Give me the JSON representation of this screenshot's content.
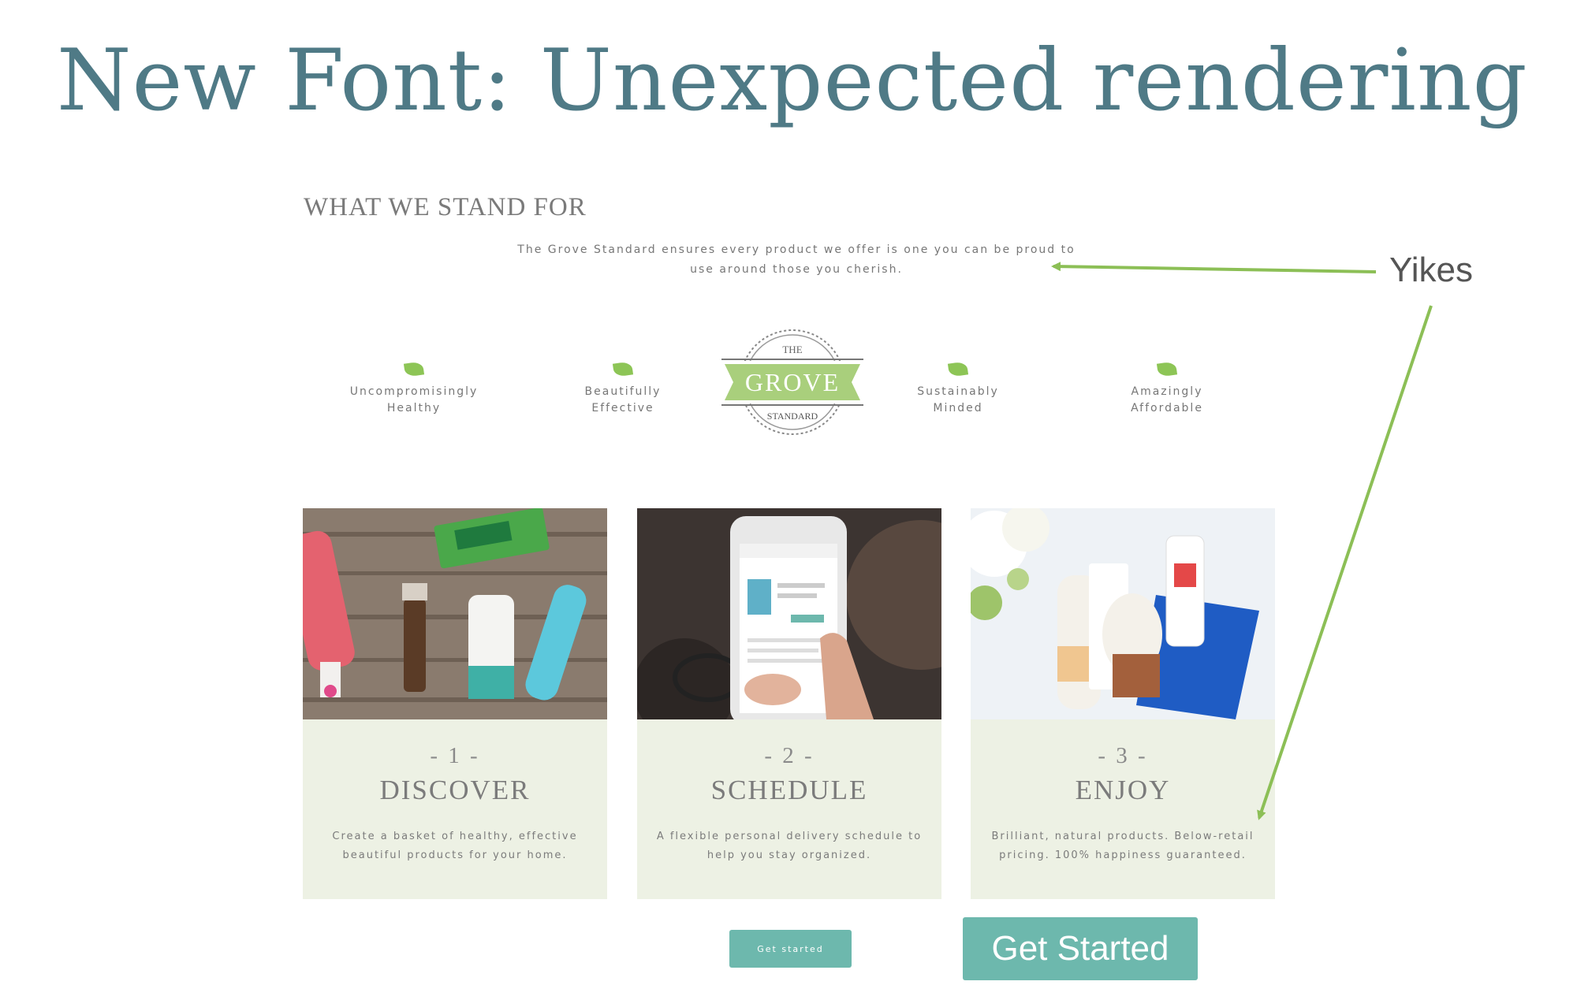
{
  "slide": {
    "title": "New Font: Unexpected rendering"
  },
  "section": {
    "heading": "WHAT WE STAND FOR",
    "tagline": "The Grove Standard ensures every product we offer is one you can be proud to use around those you cherish."
  },
  "pillars": [
    {
      "label": "Uncompromisingly\nHealthy"
    },
    {
      "label": "Beautifully\nEffective"
    },
    {
      "label": "Sustainably\nMinded"
    },
    {
      "label": "Amazingly\nAffordable"
    }
  ],
  "badge": {
    "top": "THE",
    "main": "GROVE",
    "bottom": "STANDARD"
  },
  "steps": [
    {
      "number": "- 1 -",
      "title": "DISCOVER",
      "description": "Create a basket of healthy, effective beautiful products for your home."
    },
    {
      "number": "- 2 -",
      "title": "SCHEDULE",
      "description": "A flexible personal delivery schedule to help you stay organized."
    },
    {
      "number": "- 3 -",
      "title": "ENJOY",
      "description": "Brilliant, natural products. Below-retail pricing. 100% happiness guaranteed."
    }
  ],
  "buttons": {
    "small_label": "Get started",
    "large_label": "Get Started"
  },
  "annotation": {
    "label": "Yikes"
  },
  "colors": {
    "title": "#4f7a86",
    "accent": "#6db8ad",
    "leaf": "#8dc556",
    "card_bg": "#edf1e4",
    "arrow": "#8cbf56"
  }
}
